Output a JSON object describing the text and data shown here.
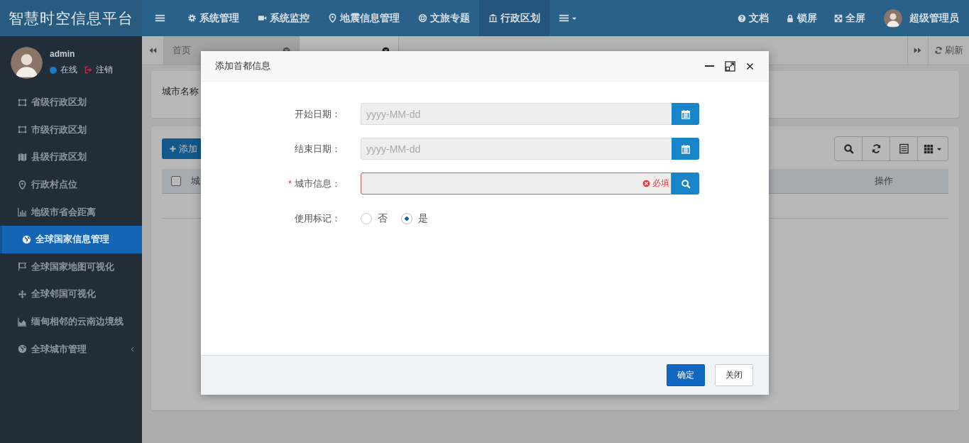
{
  "app": {
    "title": "智慧时空信息平台"
  },
  "top_menu": [
    {
      "label": "系统管理",
      "selected": false
    },
    {
      "label": "系统监控",
      "selected": false
    },
    {
      "label": "地震信息管理",
      "selected": false
    },
    {
      "label": "文旅专题",
      "selected": false
    },
    {
      "label": "行政区划",
      "selected": true
    }
  ],
  "top_right": [
    {
      "label": "文档"
    },
    {
      "label": "锁屏"
    },
    {
      "label": "全屏"
    }
  ],
  "user": {
    "name": "超级管理员"
  },
  "sidebar": {
    "user": {
      "name": "admin",
      "status": "在线",
      "logout": "注销"
    },
    "items": [
      {
        "label": "省级行政区划",
        "selected": false,
        "kind": "link"
      },
      {
        "label": "市级行政区划",
        "selected": false,
        "kind": "link"
      },
      {
        "label": "县级行政区划",
        "selected": false,
        "kind": "link"
      },
      {
        "label": "行政村点位",
        "selected": false,
        "kind": "link"
      },
      {
        "label": "地级市省会距离",
        "selected": false,
        "kind": "link"
      },
      {
        "label": "全球国家信息管理",
        "selected": true,
        "kind": "link"
      },
      {
        "label": "全球国家地图可视化",
        "selected": false,
        "kind": "link"
      },
      {
        "label": "全球邻国可视化",
        "selected": false,
        "kind": "link"
      },
      {
        "label": "缅甸相邻的云南边境线",
        "selected": false,
        "kind": "link"
      },
      {
        "label": "全球城市管理",
        "selected": false,
        "kind": "group"
      }
    ]
  },
  "tabs": [
    {
      "label": "首页",
      "selected": false,
      "closable": false
    },
    {
      "selected": false,
      "closable": true
    },
    {
      "selected": true,
      "closable": true
    }
  ],
  "refresh": "刷新",
  "search_panel": {
    "label": "城市名称"
  },
  "toolbar": {
    "add": "添加"
  },
  "table": {
    "select_all": {
      "checked": false
    },
    "columns": [
      "城",
      "操作"
    ]
  },
  "dialog": {
    "title": "添加首都信息",
    "fields": [
      {
        "kind": "date",
        "label": "开始日期：",
        "placeholder": "yyyy-MM-dd"
      },
      {
        "kind": "date",
        "label": "结束日期：",
        "placeholder": "yyyy-MM-dd"
      },
      {
        "kind": "lookup",
        "required_mark": "*",
        "label": "城市信息：",
        "error": "必填"
      },
      {
        "kind": "radio",
        "label": "使用标记：",
        "options": [
          {
            "label": "否",
            "selected": false
          },
          {
            "label": "是",
            "selected": true
          }
        ]
      }
    ],
    "buttons": [
      {
        "label": "确定",
        "kind": "primary"
      },
      {
        "label": "关闭",
        "kind": "default"
      }
    ]
  }
}
